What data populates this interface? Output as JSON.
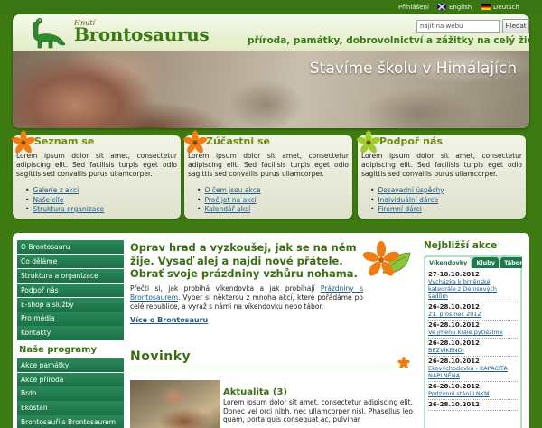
{
  "topbar": {
    "login": "Přihlášení",
    "english": "English",
    "deutsch": "Deutsch"
  },
  "header": {
    "logo_sub": "Hnutí",
    "logo_main": "Brontosaurus",
    "tagline": "příroda, památky, dobrovolnictví a zážitky na celý život",
    "search_placeholder": "najít na webu",
    "search_button": "Hledat",
    "hero_title": "Stavíme školu v Himálajích"
  },
  "boxes": [
    {
      "title": "Seznam se",
      "text": "Lorem ipsum dolor sit amet, consectetur adipiscing elit. Sed facilisis turpis eget odio sagittis sed convallis purus ullamcorper.",
      "links": [
        "Galerie z akcí",
        "Naše cíle",
        "Struktura organizace"
      ],
      "flower_color": "#f07c12"
    },
    {
      "title": "Zúčastni se",
      "text": "Lorem ipsum dolor sit amet, consectetur adipiscing elit. Sed facilisis turpis eget odio sagittis sed convallis purus ullamcorper.",
      "links": [
        "O čem jsou akce",
        "Proč jet na akci",
        "Kalendář akcí"
      ],
      "flower_color": "#f07c12"
    },
    {
      "title": "Podpoř nás",
      "text": "Lorem ipsum dolor sit amet, consectetur adipiscing elit. Sed facilisis turpis eget odio sagittis sed convallis purus ullamcorper.",
      "links": [
        "Dosavadní úspěchy",
        "Individuální dárce",
        "Firemní dárci"
      ],
      "flower_color": "#9ccf2a"
    }
  ],
  "nav": {
    "items": [
      "O Brontosauru",
      "Co děláme",
      "Struktura a organizace",
      "Podpoř nás",
      "E-shop a služby",
      "Pro média",
      "Kontakty"
    ],
    "programs_heading": "Naše programy",
    "programs": [
      "Akce památky",
      "Akce příroda",
      "Brdo",
      "Ekostan",
      "Brontosauří s Brontosaurem"
    ]
  },
  "intro": {
    "heading": "Oprav hrad a vyzkoušej, jak se na něm žije. Vysaď alej a najdi nové přátele. Obrať svoje prázdniny vzhůru nohama.",
    "text_before": "Přečti si, jak probíhá víkendovka a jak probíhají ",
    "text_link": "Prázdniny s Brontosaurem",
    "text_after": ". Vyber si některou z mnoha akcí, které pořádáme po celé republice, a vyraž s námi na víkendovku nebo tábor.",
    "more": "Více o Brontosauru"
  },
  "news": {
    "heading": "Novinky",
    "item_title": "Aktualita (3)",
    "item_text": "Lorem ipsum dolor sit amet, consectetur adipiscing elit. Donec vel orci nibh, nec ullamcorper nisl. Phasellus leo quam, porta quis consequat ac, pulvinar"
  },
  "sidebar": {
    "heading": "Nejbližší akce",
    "tabs": [
      "Víkendovky",
      "Kluby",
      "Tábory"
    ],
    "events": [
      {
        "date": "27-10.10.2012",
        "title": "Vycházka k brněnské katedrále z Denisových sadům"
      },
      {
        "date": "26-28.10.2012",
        "title": "21. prosinec 2012"
      },
      {
        "date": "26-28.10.2012",
        "title": "Ve jménu krále pytlézíme"
      },
      {
        "date": "26-28.10.2012",
        "title": "BEZVÍKEND!"
      },
      {
        "date": "26-28.10.2012",
        "title": "Ekovýchodovka - KAPACITA NAPLNĚNA"
      },
      {
        "date": "26-28.10.2012",
        "title": "Podzimní stání LNKM"
      },
      {
        "date": "26-28.10.2012",
        "title": ""
      }
    ]
  }
}
